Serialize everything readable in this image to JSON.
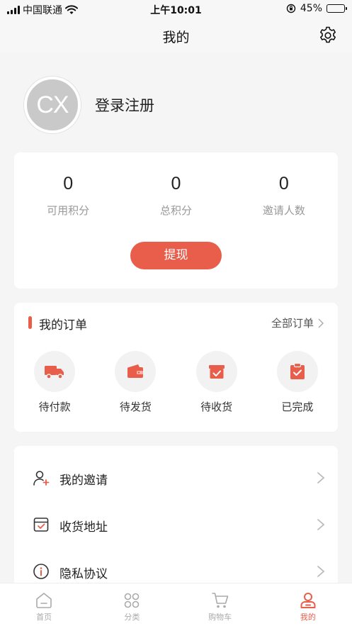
{
  "status_bar": {
    "carrier": "中国联通",
    "time": "上午10:01",
    "battery": "45%",
    "battery_level": 0.45
  },
  "nav": {
    "title": "我的",
    "settings_icon": "gear-icon"
  },
  "profile": {
    "avatar_text": "CX",
    "login_label": "登录注册"
  },
  "stats": {
    "items": [
      {
        "value": "0",
        "label": "可用积分"
      },
      {
        "value": "0",
        "label": "总积分"
      },
      {
        "value": "0",
        "label": "邀请人数"
      }
    ],
    "withdraw_label": "提现"
  },
  "orders": {
    "title": "我的订单",
    "all_label": "全部订单",
    "items": [
      {
        "label": "待付款",
        "icon": "truck-icon"
      },
      {
        "label": "待发货",
        "icon": "wallet-icon"
      },
      {
        "label": "待收货",
        "icon": "box-check-icon"
      },
      {
        "label": "已完成",
        "icon": "clipboard-check-icon"
      }
    ]
  },
  "menu": {
    "items": [
      {
        "label": "我的邀请",
        "icon": "user-add-icon"
      },
      {
        "label": "收货地址",
        "icon": "inbox-check-icon"
      },
      {
        "label": "隐私协议",
        "icon": "info-icon"
      }
    ]
  },
  "tab_bar": {
    "items": [
      {
        "label": "首页",
        "icon": "home-icon"
      },
      {
        "label": "分类",
        "icon": "grid-icon"
      },
      {
        "label": "购物车",
        "icon": "cart-icon"
      },
      {
        "label": "我的",
        "icon": "person-icon",
        "active": true
      }
    ]
  },
  "colors": {
    "accent": "#e95d4b",
    "background": "#f5f5f5",
    "muted_text": "#999999"
  }
}
